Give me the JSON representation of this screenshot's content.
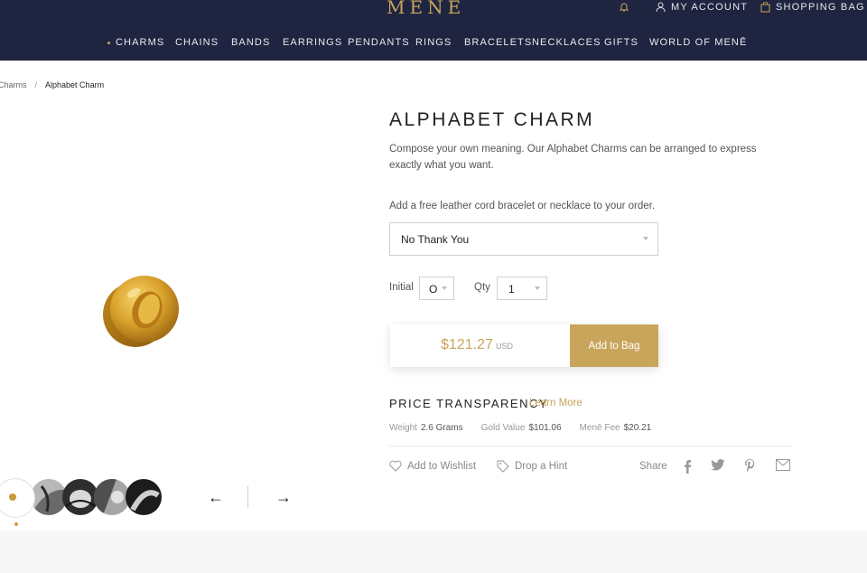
{
  "header": {
    "logo": "MENĒ",
    "account_label": "MY ACCOUNT",
    "bag_label": "SHOPPING BAG",
    "nav": [
      "CHARMS",
      "CHAINS",
      "BANDS",
      "EARRINGS",
      "PENDANTS",
      "RINGS",
      "BRACELETS",
      "NECKLACES",
      "GIFTS",
      "WORLD OF MENĒ"
    ]
  },
  "breadcrumb": {
    "parent": "Charms",
    "separator": "/",
    "current": "Alphabet Charm"
  },
  "product": {
    "title": "ALPHABET CHARM",
    "description": "Compose your own meaning. Our Alphabet Charms can be arranged to express exactly what you want.",
    "addon_label": "Add a free leather cord bracelet or necklace to your order.",
    "addon_selected": "No Thank You",
    "initial_label": "Initial",
    "initial_value": "O",
    "qty_label": "Qty",
    "qty_value": "1",
    "price": "$121.27",
    "currency": "USD",
    "add_button": "Add to Bag"
  },
  "transparency": {
    "title": "PRICE TRANSPARENCY",
    "learn_more": "Learn More",
    "weight_label": "Weight",
    "weight_value": "2.6 Grams",
    "gold_label": "Gold Value",
    "gold_value": "$101.06",
    "fee_label": "Menē Fee",
    "fee_value": "$20.21"
  },
  "actions": {
    "wishlist": "Add to Wishlist",
    "hint": "Drop a Hint",
    "share": "Share"
  },
  "gallery": {
    "prev": "←",
    "next": "→"
  },
  "colors": {
    "navy": "#1f2540",
    "gold": "#c9a55b"
  }
}
